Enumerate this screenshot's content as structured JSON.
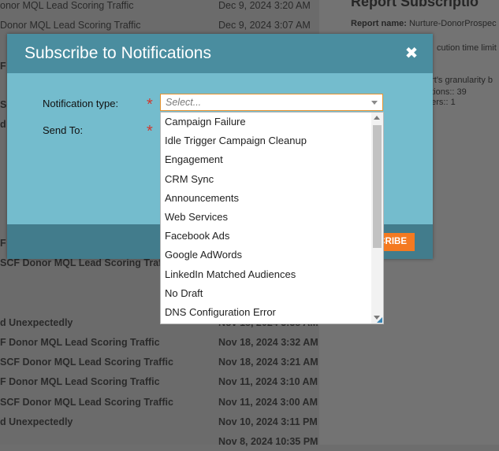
{
  "background": {
    "rows": [
      {
        "name": "onor MQL Lead Scoring Traffic",
        "date": "Dec 9, 2024 3:20 AM",
        "bold": false
      },
      {
        "name": "Donor MQL Lead Scoring Traffic",
        "date": "Dec 9, 2024 3:07 AM",
        "bold": false
      },
      {
        "name": "SCF Donor MQL Lead Scoring Traffic",
        "date": "",
        "bold": true
      },
      {
        "name": "d Unexpectedly",
        "date": "Nov 18, 2024 3:38 AM",
        "bold": true
      },
      {
        "name": "F Donor MQL Lead Scoring Traffic",
        "date": "Nov 18, 2024 3:32 AM",
        "bold": true
      },
      {
        "name": "SCF Donor MQL Lead Scoring Traffic",
        "date": "Nov 18, 2024 3:21 AM",
        "bold": true
      },
      {
        "name": "F Donor MQL Lead Scoring Traffic",
        "date": "Nov 11, 2024 3:10 AM",
        "bold": true
      },
      {
        "name": "SCF Donor MQL Lead Scoring Traffic",
        "date": "Nov 11, 2024 3:00 AM",
        "bold": true
      },
      {
        "name": "d Unexpectedly",
        "date": "Nov 10, 2024 3:11 PM",
        "bold": true
      },
      {
        "name": "",
        "date": "Nov 8, 2024 10:35 PM",
        "bold": true
      }
    ],
    "left_fragments": [
      "F",
      "SCF",
      "d",
      "F"
    ],
    "right_panel": {
      "title": "Report Subscriptio",
      "report_name_label": "Report name:",
      "report_name_value": "Nurture-DonorProspec",
      "line1": "cution time limit w",
      "line2": "ort's granularity b",
      "line3": "ptions:: 39",
      "line4": "bers:: 1"
    }
  },
  "modal": {
    "title": "Subscribe to Notifications",
    "close_symbol": "✖",
    "fields": {
      "notification_type_label": "Notification type:",
      "send_to_label": "Send To:",
      "required_marker": "*",
      "select_placeholder": "Select..."
    },
    "subscribe_label": "CRIBE"
  },
  "dropdown": {
    "options": [
      "Campaign Failure",
      "Idle Trigger Campaign Cleanup",
      "Engagement",
      "CRM Sync",
      "Announcements",
      "Web Services",
      "Facebook Ads",
      "Google AdWords",
      "LinkedIn Matched Audiences",
      "No Draft",
      "DNS Configuration Error"
    ]
  },
  "colors": {
    "modal_header": "#4a8d9f",
    "modal_body": "#74bccd",
    "accent_orange": "#f47a21",
    "required_red": "#d0372d"
  }
}
